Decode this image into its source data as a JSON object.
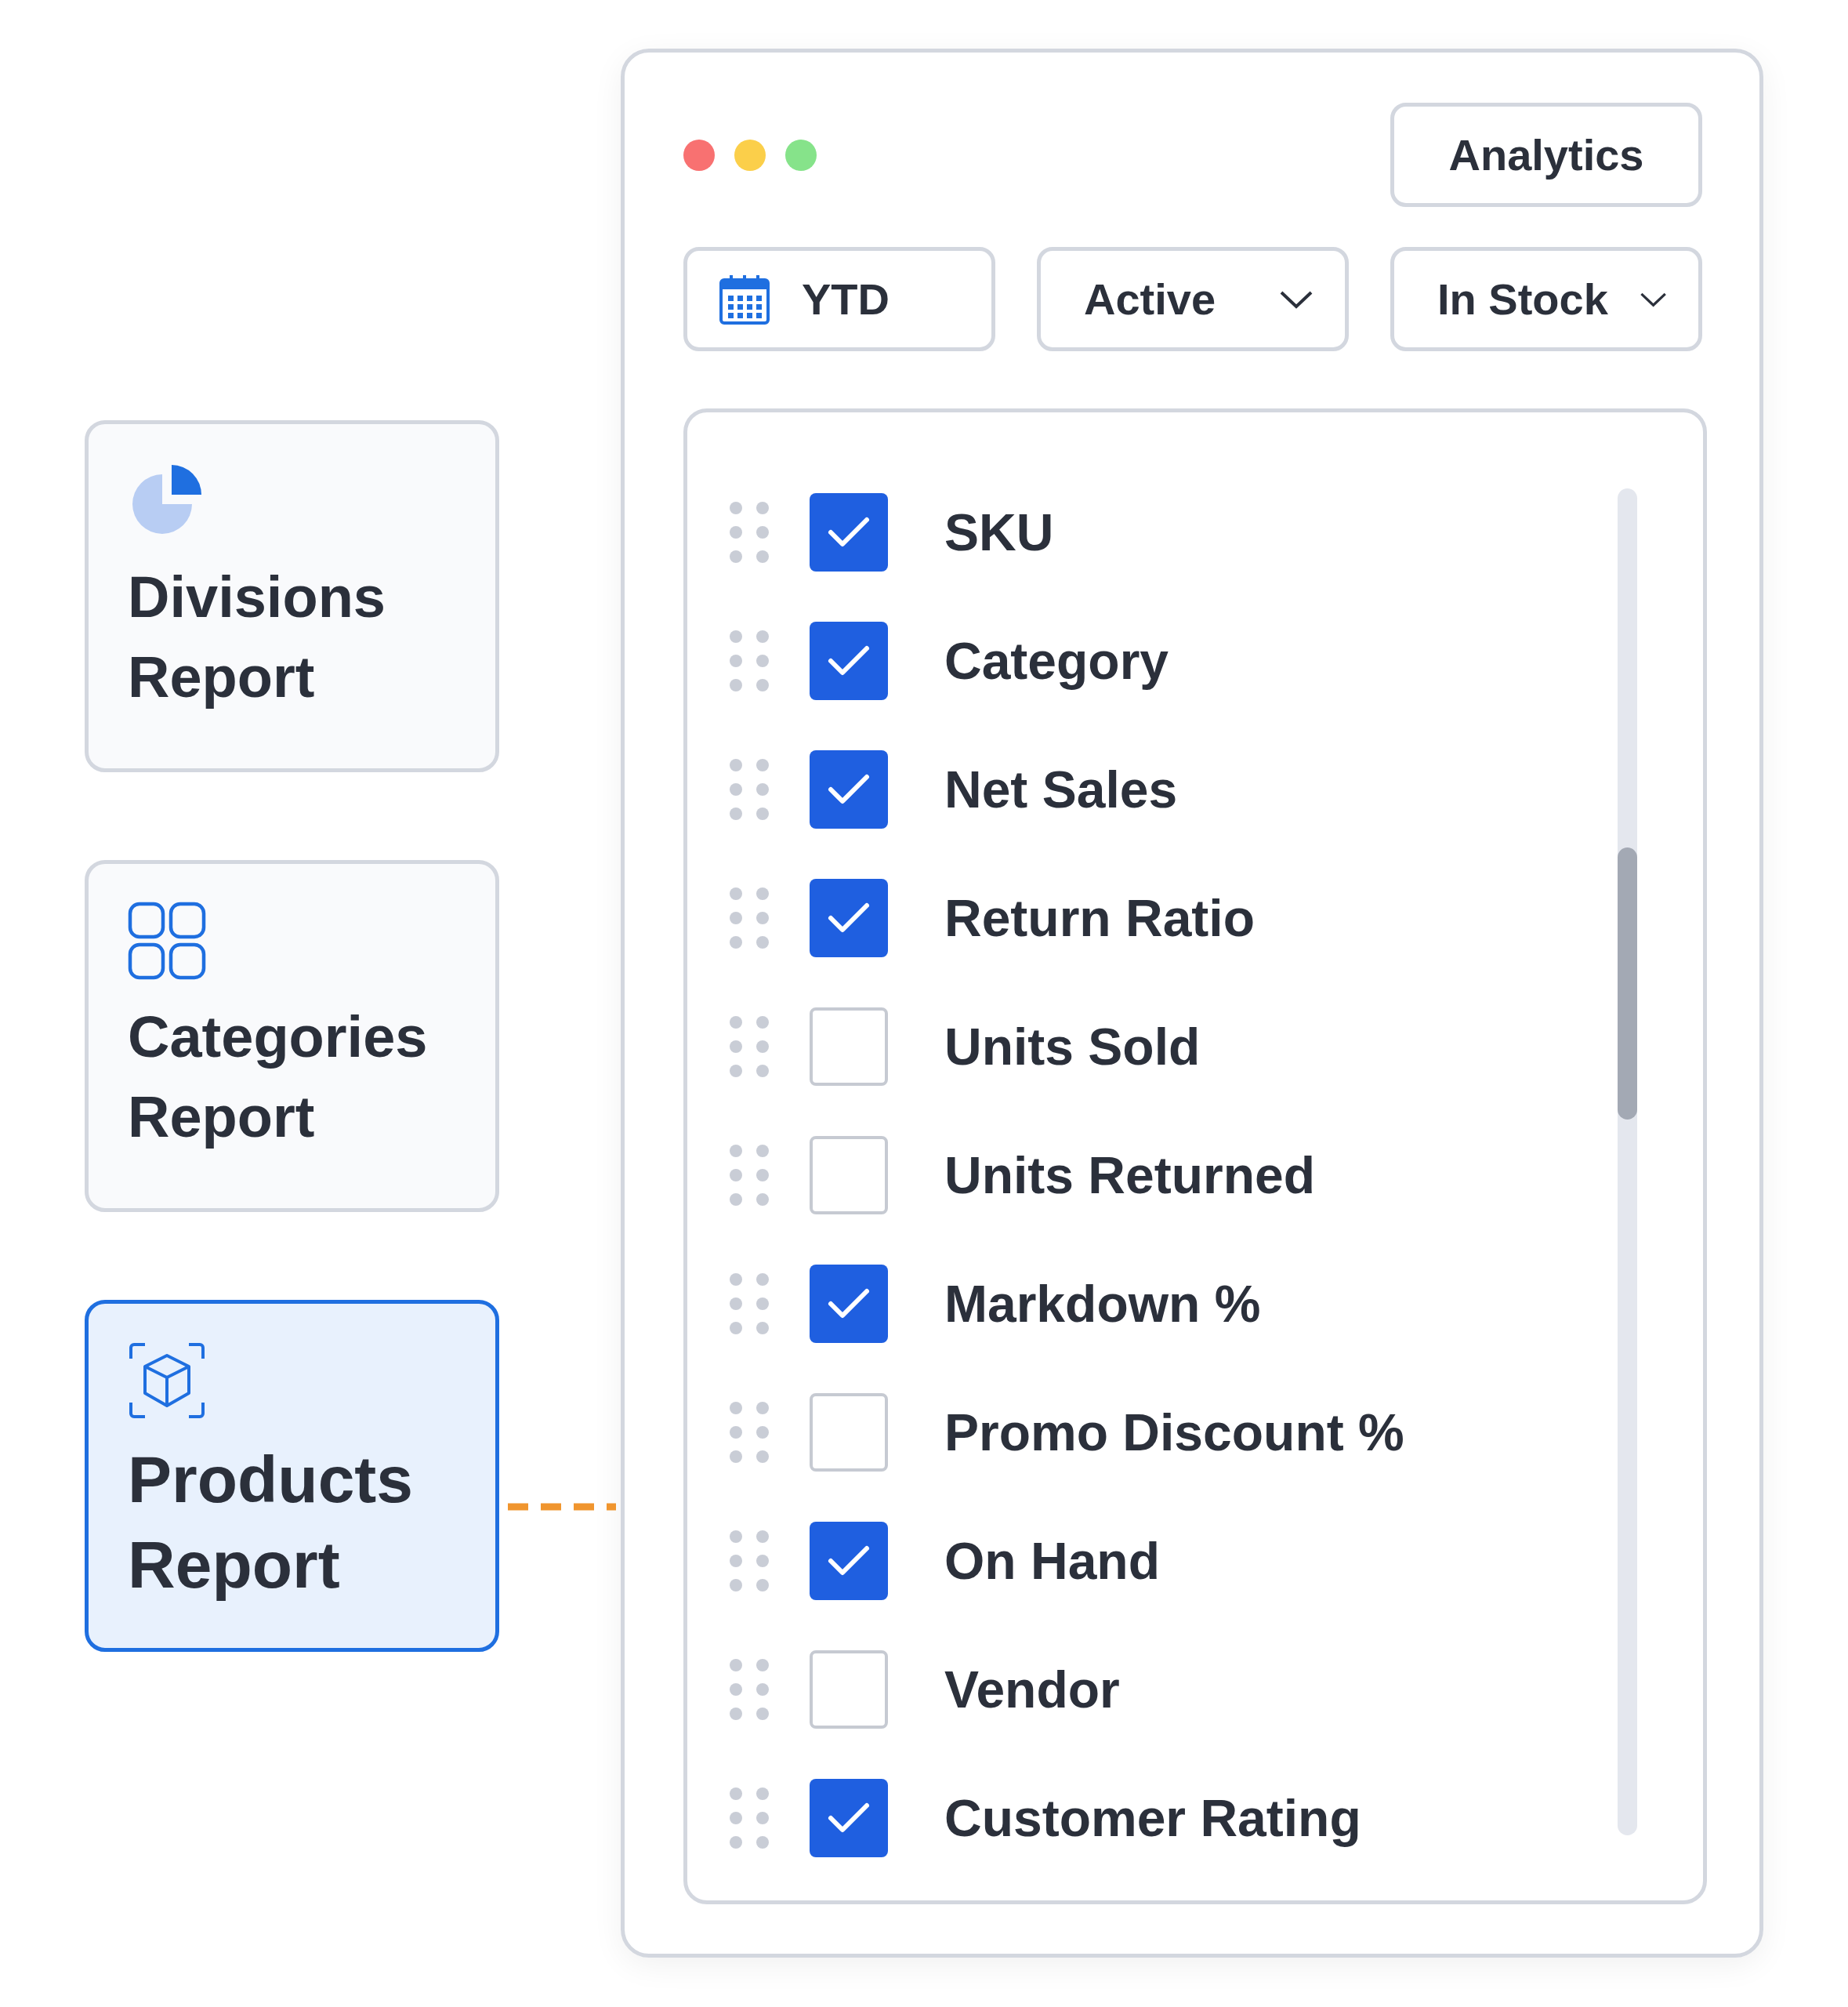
{
  "reports": [
    {
      "kind": "pie",
      "title": "Divisions Report",
      "selected": false
    },
    {
      "kind": "grid",
      "title": "Categories Report",
      "selected": false
    },
    {
      "kind": "cube",
      "title": "Products Report",
      "selected": true
    }
  ],
  "window": {
    "button": "Analytics"
  },
  "filters": [
    {
      "kind": "date",
      "value": "YTD"
    },
    {
      "kind": "dropdown",
      "value": "Active"
    },
    {
      "kind": "dropdown",
      "value": "In Stock"
    }
  ],
  "columns": [
    {
      "label": "SKU",
      "checked": true
    },
    {
      "label": "Category",
      "checked": true
    },
    {
      "label": "Net Sales",
      "checked": true
    },
    {
      "label": "Return Ratio",
      "checked": true
    },
    {
      "label": "Units Sold",
      "checked": false
    },
    {
      "label": "Units Returned",
      "checked": false
    },
    {
      "label": "Markdown %",
      "checked": true
    },
    {
      "label": "Promo Discount %",
      "checked": false
    },
    {
      "label": "On Hand",
      "checked": true
    },
    {
      "label": "Vendor",
      "checked": false
    },
    {
      "label": "Customer Rating",
      "checked": true
    }
  ]
}
